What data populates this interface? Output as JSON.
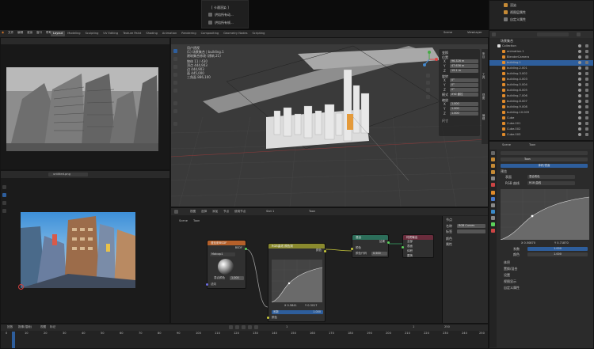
{
  "top_popup": {
    "lines": [
      "[ 卡通渲染 ]",
      "烘焙所有动...",
      "烘焙所有帧..."
    ]
  },
  "menubar": {
    "items": [
      "文件",
      "编辑",
      "渲染",
      "窗口",
      "帮助"
    ],
    "workspace_tabs": [
      "Layout",
      "Modeling",
      "Sculpting",
      "UV Editing",
      "Texture Paint",
      "Shading",
      "Animation",
      "Rendering",
      "Compositing",
      "Geometry Nodes",
      "Scripting"
    ],
    "active_tab": "Layout"
  },
  "top_right": {
    "items": [
      "渲染",
      "视图层属性",
      "自定义属性"
    ],
    "scene": "Scene",
    "view_layer": "ViewLayer"
  },
  "viewport": {
    "info_lines": [
      "用户透视",
      "(1) 场景集合 | building.1",
      "建筑集合修改 (建筑.21)",
      "物体   11 / 430",
      "顶点   444,903",
      "边     444,903",
      "面     445,000",
      "三角面 886,100"
    ],
    "transform": {
      "title": "变换",
      "fields": [
        "位置",
        "X",
        "Y",
        "Z",
        "旋转",
        "X",
        "Y",
        "Z",
        "模式",
        "缩放",
        "X",
        "Y",
        "Z",
        "尺寸"
      ],
      "values": [
        "96.326 m",
        "47.636 m",
        "19.1 m",
        "0°",
        "0°",
        "0°",
        "XYZ 欧拉",
        "1.000",
        "1.000",
        "1.000"
      ]
    },
    "sidebar_tabs": [
      "条目",
      "工具",
      "视图",
      "编辑"
    ]
  },
  "image_editor_bottom": {
    "filename": "untitled.png"
  },
  "node_editor": {
    "header_items": [
      "视图",
      "选择",
      "添加",
      "节点",
      "使用节点"
    ],
    "slot": "Slot 1",
    "material": "Toon",
    "breadcrumb": [
      "Scene",
      "Toon"
    ],
    "nodes": {
      "diffuse": {
        "title": "漫反射BSDF",
        "output": "BSDF",
        "material": "Matcap1",
        "field_label": "混合颜色",
        "field_value": "1.000",
        "input": "法向"
      },
      "rgb": {
        "title": "RGB曲线 颜色到",
        "output": "颜色",
        "factor_label": "系数",
        "factor_value": "1.000",
        "input": "颜色",
        "coords": [
          "X 0.5841",
          "Y 0.3017"
        ]
      },
      "mix": {
        "title": "混合",
        "output": "结果",
        "input1": "颜色",
        "input2": "颜色代码",
        "field_value": "0.500"
      },
      "out": {
        "title": "材质输出",
        "input1": "全部",
        "input2": "表面",
        "input3": "体积",
        "input4": "置换"
      }
    },
    "right_panel": {
      "label1": "节点",
      "label2": "名称",
      "value2": "RGB Curves",
      "label3": "标签",
      "label4": "颜色",
      "label5": "属性"
    }
  },
  "timeline": {
    "frame": "1",
    "labels": [
      "回放",
      "抠像(插帧)",
      "视图",
      "标记"
    ],
    "frames": [
      "0",
      "10",
      "20",
      "30",
      "40",
      "50",
      "60",
      "70",
      "80",
      "90",
      "100",
      "110",
      "120",
      "130",
      "140",
      "150",
      "160",
      "170",
      "180",
      "190",
      "200",
      "210",
      "220",
      "230",
      "240",
      "250"
    ],
    "start": "1",
    "end": "250"
  },
  "outliner": {
    "header": "场景集合",
    "items": [
      "Collection",
      "animation.1",
      "BlenderCamera",
      "building.1",
      "building.2.001",
      "building.3.002",
      "building.4.003",
      "building.5.004",
      "building.6.005",
      "building.7.006",
      "building.8.007",
      "building.9.008",
      "building.10.009",
      "Cube",
      "Cube.001",
      "Cube.002",
      "Cube.003"
    ]
  },
  "properties": {
    "scene_label": "Scene",
    "material_name": "Toon",
    "surface": "表面",
    "header_btn": "体积/表面",
    "rows": [
      "预览",
      "表面",
      "混合着色",
      "RGB 曲线"
    ],
    "curve_label": "RGB 曲线",
    "fields": [
      "系数",
      "颜色"
    ],
    "factor": "1.000",
    "color": "1.000",
    "coords": [
      "X 0.50870",
      "Y 0.71870"
    ],
    "sections": [
      "体积",
      "置换/混合",
      "设置",
      "视图显示",
      "自定义属性"
    ]
  },
  "colors": {
    "accent_blue": "#2e5e9c",
    "diffuse_head": "#b5602a",
    "rgb_head": "#8a8a2e",
    "mix_head": "#2c6e5a",
    "out_head": "#6a2c3c",
    "grid": "#3a3a3a"
  }
}
